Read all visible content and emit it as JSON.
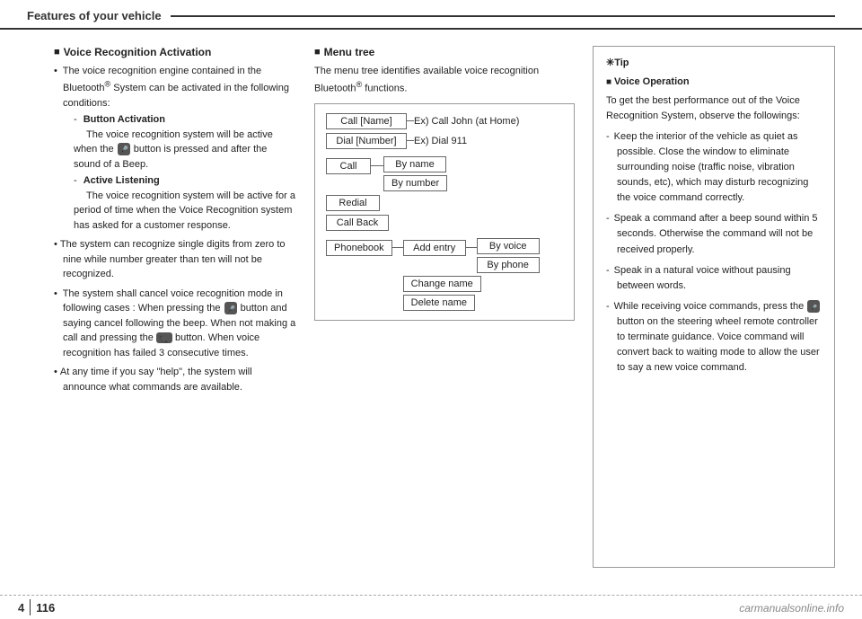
{
  "header": {
    "title": "Features of your vehicle"
  },
  "left_col": {
    "section1_title": "Voice Recognition Activation",
    "items": [
      {
        "text": "The voice recognition engine contained in the Bluetooth® System can be activated in the following conditions:",
        "sub": [
          {
            "label": "Button Activation",
            "detail": "The voice recognition system will be active when the  button is pressed and after the sound of a Beep."
          },
          {
            "label": "Active Listening",
            "detail": "The voice recognition system will be active for a period of time when the Voice Recognition system has asked for a customer response."
          }
        ]
      },
      {
        "text": "The system can recognize single digits from zero to nine while number greater than ten will not be recognized."
      },
      {
        "text": "The system shall cancel voice recognition mode in following cases : When pressing the  button and saying cancel following the beep. When not making a call and pressing the  button. When voice recognition has failed 3 consecutive times."
      },
      {
        "text": "At any time if you say \"help\", the system will announce what commands are available."
      }
    ]
  },
  "middle_col": {
    "section_title": "Menu tree",
    "intro": "The menu tree identifies available voice recognition Bluetooth® functions.",
    "tree": {
      "row1_label": "Call [Name]",
      "row1_example": "Ex) Call John (at Home)",
      "row2_label": "Dial [Number]",
      "row2_example": "Ex) Dial 911",
      "call_node": "Call",
      "by_name": "By name",
      "by_number": "By number",
      "redial": "Redial",
      "call_back": "Call Back",
      "phonebook": "Phonebook",
      "add_entry": "Add entry",
      "by_voice": "By voice",
      "by_phone": "By phone",
      "change_name": "Change name",
      "delete_name": "Delete name"
    }
  },
  "right_col": {
    "tip_marker": "✳Tip",
    "section_title": "Voice Operation",
    "intro": "To get the best performance out of the Voice Recognition System, observe the followings:",
    "bullets": [
      "Keep the interior of the vehicle as quiet as possible. Close the window to eliminate surrounding noise (traffic noise, vibration sounds, etc), which may disturb recognizing the voice command correctly.",
      "Speak a command after a beep sound within 5 seconds. Otherwise the command will not be received properly.",
      "Speak in a natural voice without pausing between words.",
      "While receiving voice commands, press the  button on the steering wheel remote controller to terminate guidance. Voice command will convert back to waiting mode to allow the user to say a new voice command."
    ]
  },
  "footer": {
    "page_section": "4",
    "page_number": "116",
    "watermark": "carmanualsonline.info"
  }
}
